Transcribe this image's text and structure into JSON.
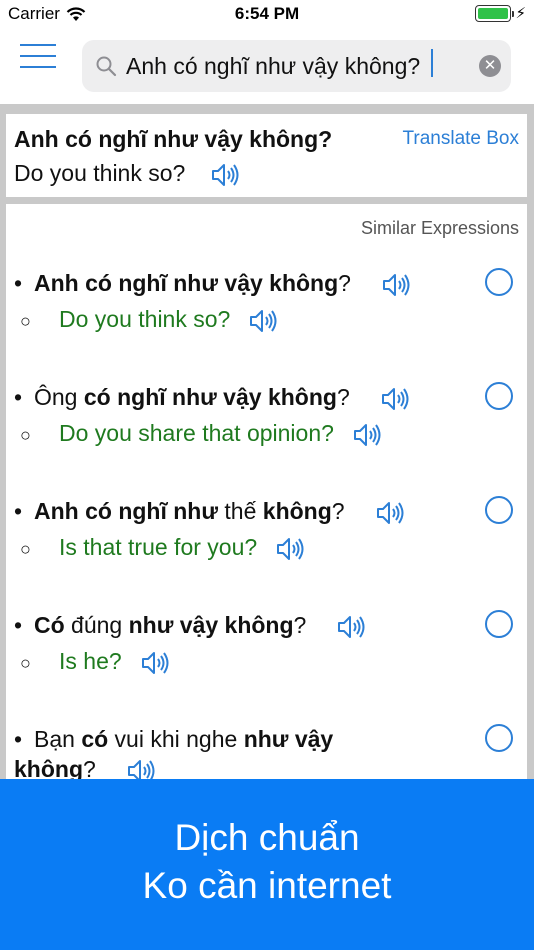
{
  "status_bar": {
    "carrier": "Carrier",
    "time": "6:54 PM",
    "battery_level": 1.0,
    "battery_color": "#2fc248"
  },
  "search": {
    "value": "Anh có nghĩ như vậy không?",
    "clear_label": "✕"
  },
  "translation": {
    "source": "Anh có nghĩ như vậy không?",
    "target": "Do you think so?",
    "translate_box_label": "Translate Box"
  },
  "similar": {
    "header": "Similar Expressions",
    "items": [
      {
        "vi_parts": [
          [
            "Anh có nghĩ như vậy không",
            true
          ],
          [
            "?",
            false
          ]
        ],
        "en": "Do you think so?"
      },
      {
        "vi_parts": [
          [
            "Ông ",
            false
          ],
          [
            "có nghĩ như vậy không",
            true
          ],
          [
            "?",
            false
          ]
        ],
        "en": "Do you share that opinion?"
      },
      {
        "vi_parts": [
          [
            "Anh có nghĩ như",
            true
          ],
          [
            " thế ",
            false
          ],
          [
            "không",
            true
          ],
          [
            "?",
            false
          ]
        ],
        "en": "Is that true for you?"
      },
      {
        "vi_parts": [
          [
            "Có",
            true
          ],
          [
            " đúng ",
            false
          ],
          [
            "như vậy không",
            true
          ],
          [
            "?",
            false
          ]
        ],
        "en": "Is he?"
      },
      {
        "vi_parts": [
          [
            "Bạn ",
            false
          ],
          [
            "có",
            true
          ],
          [
            " vui khi nghe ",
            false
          ],
          [
            "như vậy không",
            true
          ],
          [
            "?",
            false
          ]
        ],
        "en": ""
      }
    ]
  },
  "banner": {
    "line1": "Dịch chuẩn",
    "line2": "Ko cần internet"
  },
  "colors": {
    "accent": "#2c7fd6",
    "english_text": "#1f7a1f",
    "banner": "#0a7cf4"
  }
}
